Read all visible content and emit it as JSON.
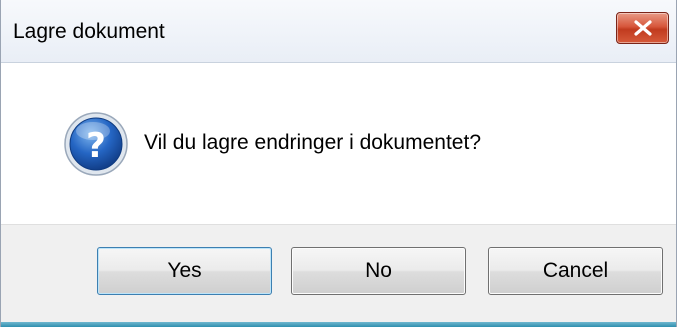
{
  "window": {
    "title": "Lagre dokument",
    "close_icon": "close-icon"
  },
  "message": {
    "icon": "question-icon",
    "text": "Vil du lagre endringer i dokumentet?"
  },
  "buttons": {
    "yes": "Yes",
    "no": "No",
    "cancel": "Cancel"
  },
  "colors": {
    "close_button": "#c9452a",
    "icon_blue": "#1f5fb8",
    "footer_bg": "#f0f0f0"
  }
}
